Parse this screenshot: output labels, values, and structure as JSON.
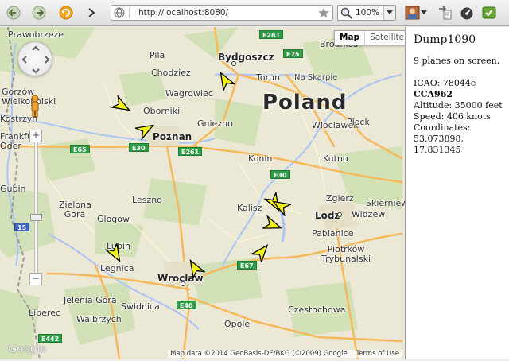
{
  "browser": {
    "url": "http://localhost:8080/",
    "zoom": "100%"
  },
  "map": {
    "map_type": {
      "map": "Map",
      "satellite": "Satellite"
    },
    "country_label": "Poland",
    "attribution": "Map data ©2014 GeoBasis-DE/BKG (©2009) Google",
    "terms": "Terms of Use",
    "logo": "Google",
    "zoom_in": "+",
    "zoom_out": "−",
    "cities": [
      "Prawobrzeże",
      "Pila",
      "Chodziez",
      "Wagrowiec",
      "Oborniki",
      "Gniezno",
      "Poznan",
      "Bydgoszcz",
      "Torun",
      "Na Skarpie",
      "Brodnica",
      "Wloclawek",
      "Plock",
      "Konin",
      "Kutno",
      "Zgierz",
      "Skierniewice",
      "Kalisz",
      "Lodz",
      "Widzew",
      "Pabianice",
      "Piotrków Trybunalski",
      "Leszno",
      "Zielona Gora",
      "Glogow",
      "Lubin",
      "Legnica",
      "Wroclaw",
      "Jelenia Góra",
      "Swidnica",
      "Walbrzych",
      "Liberec",
      "Opole",
      "Czestochowa",
      "Gorzów Wielkopolski",
      "Kostrzyn",
      "Frankfurt Oder",
      "Gubin"
    ],
    "roads": [
      "E261",
      "E75",
      "E65",
      "E30",
      "E261",
      "E30",
      "E67",
      "E40",
      "E442",
      "15"
    ]
  },
  "sidebar": {
    "title": "Dump1090",
    "planes_count": "9 planes on screen.",
    "icao": "ICAO: 78044e",
    "callsign": "CCA962",
    "altitude": "Altitude: 35000 feet",
    "speed": "Speed: 406 knots",
    "coords_label": "Coordinates:",
    "lat": "53.073898,",
    "lon": "17.831345"
  },
  "colors": {
    "plane_fill": "#f3f31a",
    "plane_stroke": "#000000",
    "land": "#ece8d6",
    "water": "#a9c4f5",
    "road_major": "#f5b85a",
    "forest": "#cfe0b3"
  }
}
